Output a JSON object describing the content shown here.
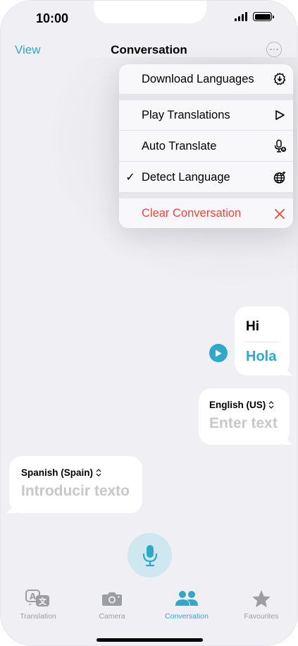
{
  "status_bar": {
    "time": "10:00"
  },
  "nav": {
    "view_label": "View",
    "title": "Conversation"
  },
  "menu": {
    "items": [
      {
        "label": "Download Languages",
        "checked": false,
        "icon": "download-settings-icon"
      },
      {
        "label": "Play Translations",
        "checked": false,
        "icon": "play-outline-icon"
      },
      {
        "label": "Auto Translate",
        "checked": false,
        "icon": "mic-auto-icon"
      },
      {
        "label": "Detect Language",
        "checked": true,
        "check_mark": "✓",
        "icon": "globe-sparkle-icon"
      },
      {
        "label": "Clear Conversation",
        "checked": false,
        "icon": "close-icon",
        "color": "#e9463a"
      }
    ]
  },
  "conversation": {
    "message": {
      "source": "Hi",
      "translation": "Hola"
    },
    "english_input": {
      "language": "English (US)",
      "placeholder": "Enter text"
    },
    "spanish_input": {
      "language": "Spanish (Spain)",
      "placeholder": "Introducir texto"
    }
  },
  "tabs": [
    {
      "label": "Translation",
      "icon": "translate-icon",
      "active": false
    },
    {
      "label": "Camera",
      "icon": "camera-icon",
      "active": false
    },
    {
      "label": "Conversation",
      "icon": "people-icon",
      "active": true
    },
    {
      "label": "Favourites",
      "icon": "star-icon",
      "active": false
    }
  ],
  "colors": {
    "accent": "#2fa8c9",
    "danger": "#e9463a",
    "background": "#f0f0f4"
  }
}
